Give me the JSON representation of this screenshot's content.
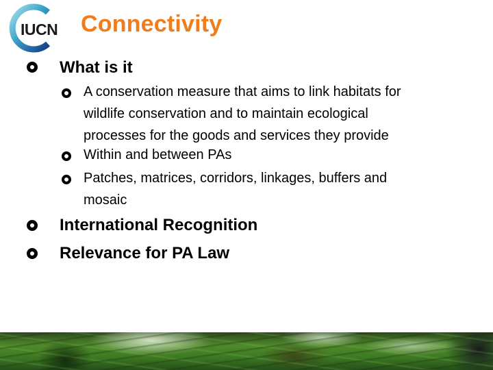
{
  "logo": {
    "text": "IUCN",
    "ring_colors": [
      "#8fd3e0",
      "#2a8fc0",
      "#143f8a"
    ]
  },
  "title": "Connectivity",
  "colors": {
    "title": "#f07c1b",
    "body_text": "#000000"
  },
  "bullets": [
    {
      "text": "What is it",
      "sub": [
        {
          "lines": [
            "A conservation measure that aims to link habitats for",
            "wildlife conservation and to maintain ecological",
            "processes for the goods and services they provide"
          ]
        },
        {
          "lines": [
            "Within and between PAs"
          ]
        },
        {
          "lines": [
            "Patches, matrices, corridors, linkages, buffers and",
            "mosaic"
          ]
        }
      ]
    },
    {
      "text": "International Recognition"
    },
    {
      "text": "Relevance for PA Law"
    }
  ],
  "banner": {
    "image": "forest-canopy-photo"
  }
}
